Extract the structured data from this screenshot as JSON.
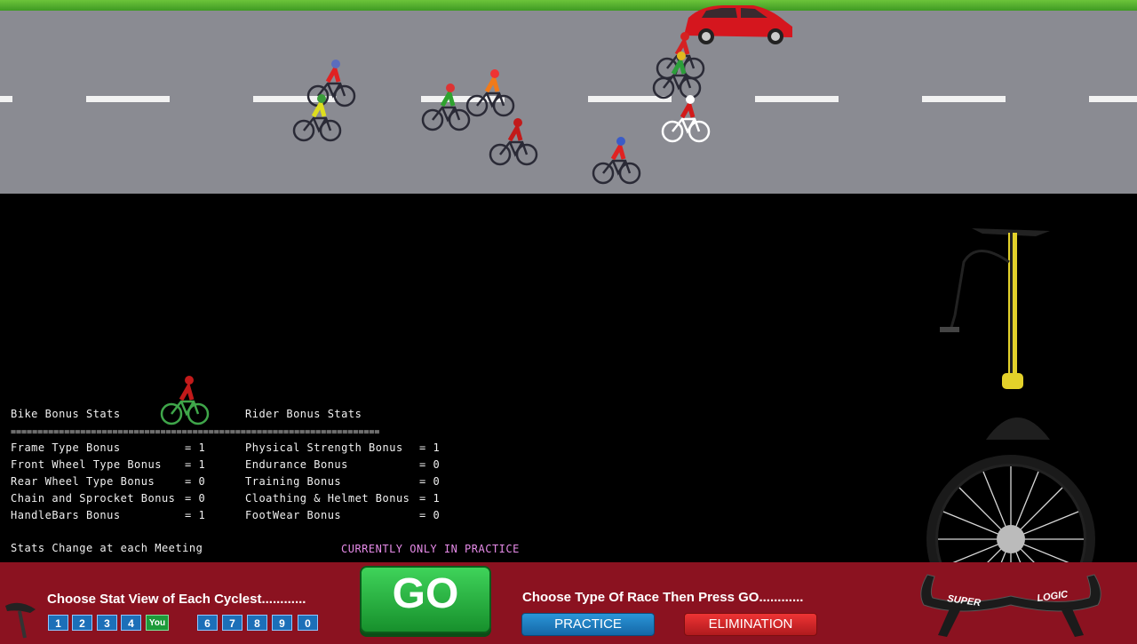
{
  "bike_stats": {
    "title": "Bike Bonus Stats",
    "divider": "=====================================================================",
    "items": [
      {
        "label": "Frame Type Bonus",
        "value": "= 1"
      },
      {
        "label": "Front Wheel Type Bonus",
        "value": "= 1"
      },
      {
        "label": "Rear Wheel Type Bonus",
        "value": "= 0"
      },
      {
        "label": "Chain and Sprocket Bonus",
        "value": "= 0"
      },
      {
        "label": "HandleBars Bonus",
        "value": "= 1"
      }
    ]
  },
  "rider_stats": {
    "title": "Rider Bonus Stats",
    "items": [
      {
        "label": "Physical Strength Bonus",
        "value": "= 1"
      },
      {
        "label": "Endurance Bonus",
        "value": "= 0"
      },
      {
        "label": "Training Bonus",
        "value": "= 0"
      },
      {
        "label": "Cloathing & Helmet Bonus",
        "value": "= 1"
      },
      {
        "label": "FootWear Bonus",
        "value": "= 0"
      }
    ]
  },
  "footnote": "Stats Change at each Meeting",
  "notice": "CURRENTLY ONLY IN PRACTICE",
  "bottom": {
    "choose_stat": "Choose Stat View of Each Cyclest............",
    "choose_race": "Choose Type Of Race Then Press GO............",
    "cyclists": [
      "1",
      "2",
      "3",
      "4",
      "You",
      "6",
      "7",
      "8",
      "9",
      "0"
    ],
    "go": "GO",
    "practice": "PRACTICE",
    "elimination": "ELIMINATION"
  },
  "handlebar_brand": {
    "left": "SUPER",
    "right": "LOGIC"
  },
  "colors": {
    "road": "#8a8b92",
    "grass": "#4fae2c",
    "bottom_bar": "#8b1220",
    "go_button": "#2bb446",
    "practice": "#1b7fc2",
    "elimination": "#d32328"
  }
}
